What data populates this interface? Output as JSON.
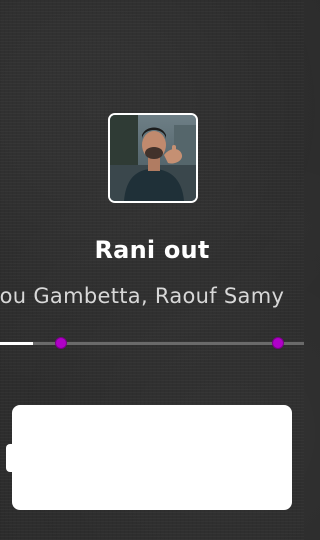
{
  "track": {
    "title": "Rani out",
    "artists": "Lou Gambetta, Raouf Samy",
    "progress_fraction": 0.11,
    "marker_fractions": [
      0.2,
      0.915
    ]
  },
  "colors": {
    "background": "#2b2b2b",
    "marker": "#b000c8",
    "track_fill": "#ffffff",
    "track_bg": "#6a6a6a"
  }
}
